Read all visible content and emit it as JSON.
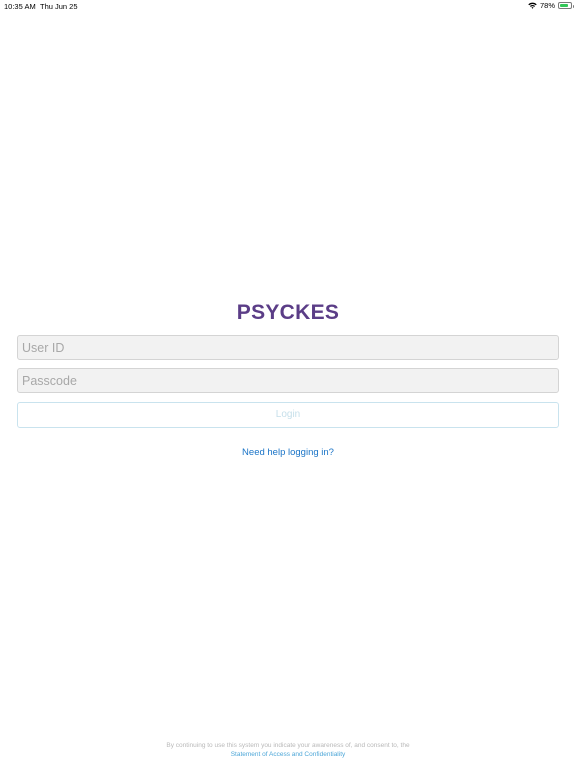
{
  "status_bar": {
    "time": "10:35 AM",
    "date": "Thu Jun 25",
    "battery": "78%",
    "battery_level": 0.78,
    "wifi_icon": "wifi-icon",
    "battery_icon": "battery-icon"
  },
  "login": {
    "title": "PSYCKES",
    "userid_placeholder": "User ID",
    "passcode_placeholder": "Passcode",
    "login_label": "Login",
    "help_label": "Need help logging in?"
  },
  "footer": {
    "text": "By continuing to use this system you indicate your awareness of, and consent to, the",
    "link": "Statement of Access and Confidentiality"
  },
  "colors": {
    "brand": "#5b3d87",
    "link": "#1a74c7",
    "battery": "#34c759"
  }
}
